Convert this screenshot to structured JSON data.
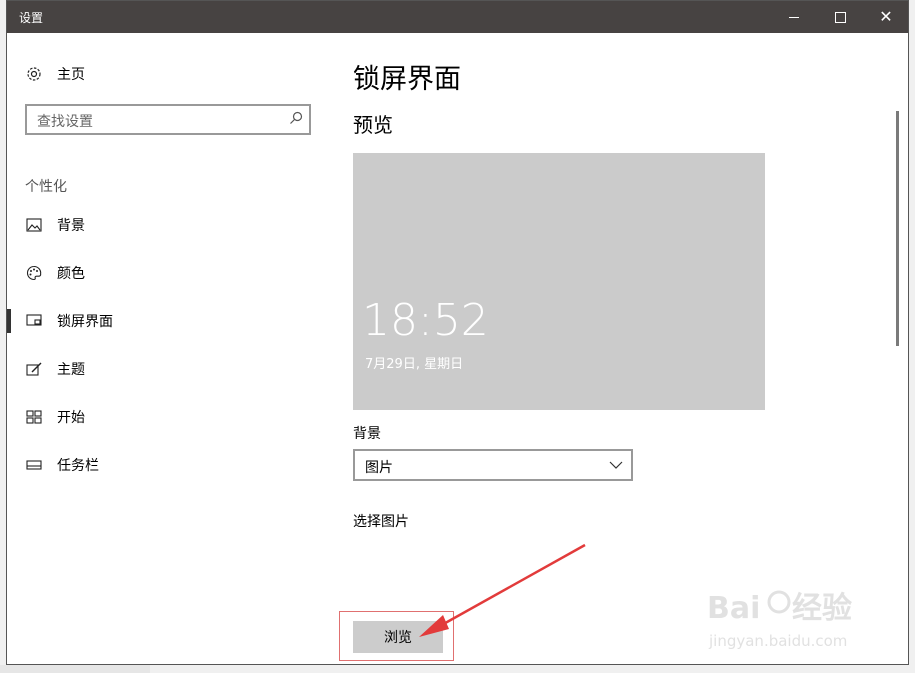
{
  "window": {
    "title": "设置",
    "controls": {
      "minimize": "minimize",
      "maximize": "maximize",
      "close": "✕"
    }
  },
  "sidebar": {
    "home_label": "主页",
    "search_placeholder": "查找设置",
    "section_title": "个性化",
    "items": [
      {
        "label": "背景",
        "icon": "picture-icon"
      },
      {
        "label": "颜色",
        "icon": "palette-icon"
      },
      {
        "label": "锁屏界面",
        "icon": "lock-screen-icon",
        "active": true
      },
      {
        "label": "主题",
        "icon": "theme-icon"
      },
      {
        "label": "开始",
        "icon": "start-icon"
      },
      {
        "label": "任务栏",
        "icon": "taskbar-icon"
      }
    ]
  },
  "main": {
    "title": "锁屏界面",
    "preview_heading": "预览",
    "preview_time": "18:52",
    "preview_date": "7月29日, 星期日",
    "background_label": "背景",
    "background_value": "图片",
    "choose_label": "选择图片",
    "browse_button": "浏览"
  },
  "watermark": {
    "brand": "Baidu经验",
    "url": "jingyan.baidu.com"
  },
  "colors": {
    "titlebar": "#474342",
    "preview_bg": "#cbcbcb",
    "highlight": "#e07070",
    "arrow": "#e23b3b"
  }
}
